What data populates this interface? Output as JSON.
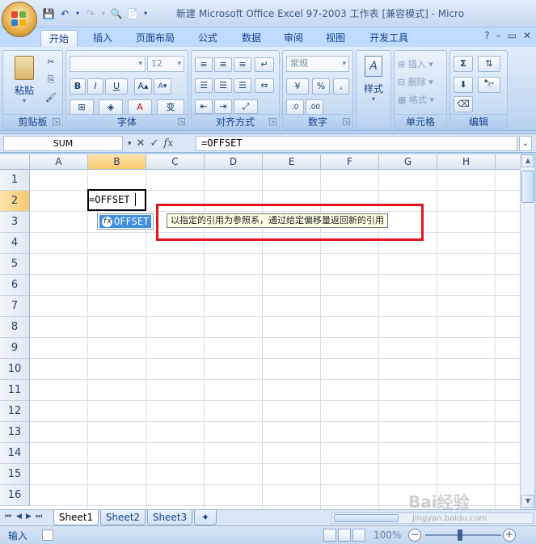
{
  "window": {
    "title": "新建 Microsoft Office Excel 97-2003 工作表 [兼容模式] - Micro"
  },
  "ribbon_tabs": [
    "开始",
    "插入",
    "页面布局",
    "公式",
    "数据",
    "审阅",
    "视图",
    "开发工具"
  ],
  "groups": {
    "clipboard": {
      "label": "剪贴板",
      "paste": "粘贴"
    },
    "font": {
      "label": "字体",
      "size": "12",
      "bold": "B",
      "italic": "I",
      "underline": "U",
      "wen": "变"
    },
    "alignment": {
      "label": "对齐方式"
    },
    "number": {
      "label": "数字",
      "format": "常规",
      "percent": "%",
      "comma": ","
    },
    "styles": {
      "label": "",
      "button": "样式"
    },
    "cells": {
      "label": "单元格",
      "insert": "插入",
      "delete": "删除",
      "format": "格式"
    },
    "editing": {
      "label": "编辑"
    }
  },
  "formula_bar": {
    "name_box": "SUM",
    "fx": "fx",
    "formula": "=OFFSET"
  },
  "grid": {
    "columns": [
      "A",
      "B",
      "C",
      "D",
      "E",
      "F",
      "G",
      "H"
    ],
    "rows": [
      "1",
      "2",
      "3",
      "4",
      "5",
      "6",
      "7",
      "8",
      "9",
      "10",
      "11",
      "12",
      "13",
      "14",
      "15",
      "16"
    ],
    "active_cell_text": "=OFFSET"
  },
  "autocomplete": {
    "item": "OFFSET",
    "tooltip": "以指定的引用为参照系，通过给定偏移量返回新的引用"
  },
  "sheets": [
    "Sheet1",
    "Sheet2",
    "Sheet3"
  ],
  "status": {
    "mode": "输入",
    "zoom": "100%"
  },
  "watermark": {
    "brand": "Bai经验",
    "url": "jingyan.baidu.com"
  },
  "colors": {
    "highlight_box": "#e4141c",
    "autocomplete_selected": "#3f8ee0",
    "selected_header": "#f8c96e"
  }
}
